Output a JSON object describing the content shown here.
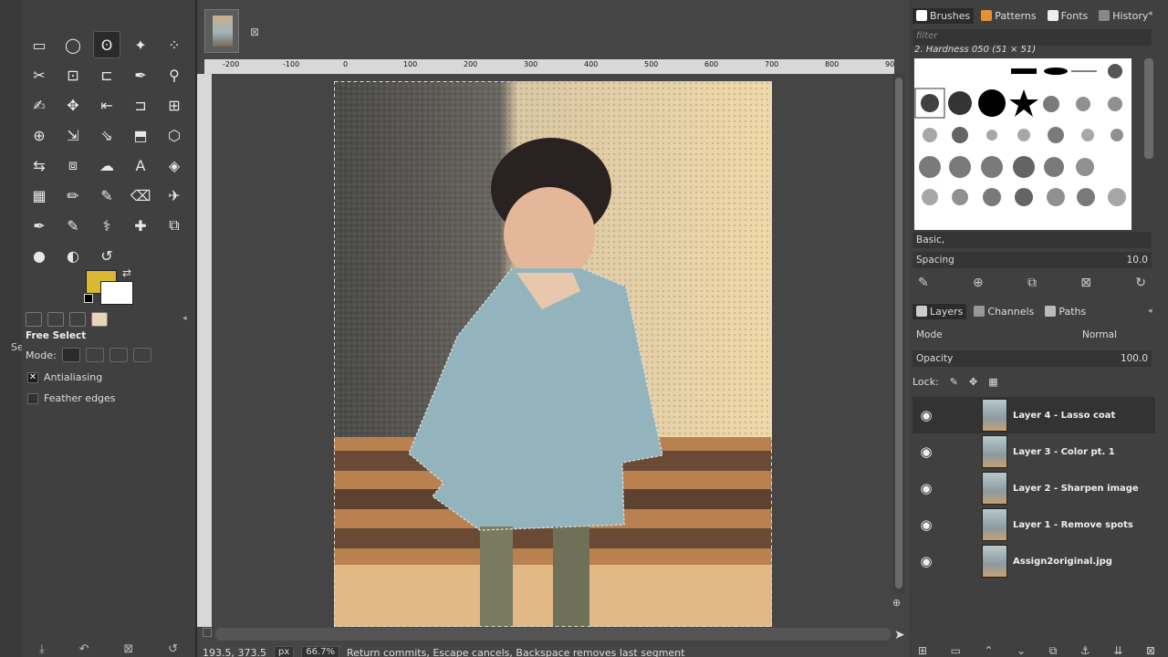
{
  "toolbox": {
    "tools": [
      {
        "name": "rect-select-icon"
      },
      {
        "name": "ellipse-select-icon"
      },
      {
        "name": "free-select-icon",
        "active": true
      },
      {
        "name": "fuzzy-select-icon"
      },
      {
        "name": "select-by-color-icon"
      },
      {
        "name": "scissors-select-icon"
      },
      {
        "name": "foreground-select-icon"
      },
      {
        "name": "crop-icon"
      },
      {
        "name": "color-picker-icon"
      },
      {
        "name": "zoom-icon"
      },
      {
        "name": "paths-icon"
      },
      {
        "name": "move-icon"
      },
      {
        "name": "align-icon"
      },
      {
        "name": "transform-icon"
      },
      {
        "name": "unified-transform-icon"
      },
      {
        "name": "warp-icon"
      },
      {
        "name": "scale-icon"
      },
      {
        "name": "shear-icon"
      },
      {
        "name": "perspective-icon"
      },
      {
        "name": "3d-transform-icon"
      },
      {
        "name": "flip-icon"
      },
      {
        "name": "cage-icon"
      },
      {
        "name": "smudge-icon"
      },
      {
        "name": "text-icon"
      },
      {
        "name": "bucket-fill-icon"
      },
      {
        "name": "gradient-icon"
      },
      {
        "name": "pencil-icon"
      },
      {
        "name": "paintbrush-icon"
      },
      {
        "name": "eraser-icon"
      },
      {
        "name": "airbrush-icon"
      },
      {
        "name": "ink-icon"
      },
      {
        "name": "mypaint-icon"
      },
      {
        "name": "clone-icon"
      },
      {
        "name": "heal-icon"
      },
      {
        "name": "perspective-clone-icon"
      },
      {
        "name": "blur-icon"
      },
      {
        "name": "dodge-icon"
      },
      {
        "name": "smudge-brush-icon"
      }
    ],
    "fg_color": "#d9b832",
    "bg_color": "#ffffff",
    "tool_options_title": "Free Select",
    "mode_label": "Mode:",
    "antialiasing_label": "Antialiasing",
    "antialiasing_checked": true,
    "feather_label": "Feather edges",
    "feather_checked": false,
    "left_fragment": "Se"
  },
  "canvas": {
    "ruler_ticks": [
      "-200",
      "-100",
      "0",
      "100",
      "200",
      "300",
      "400",
      "500",
      "600",
      "700",
      "800",
      "90"
    ],
    "status": {
      "coords": "193.5, 373.5",
      "unit": "px",
      "zoom": "66.7%",
      "message": "Return commits, Escape cancels, Backspace removes last segment"
    }
  },
  "dock": {
    "top_tabs": [
      "Brushes",
      "Patterns",
      "Fonts",
      "History"
    ],
    "filter_placeholder": "filter",
    "brush_name": "2. Hardness 050 (51 × 51)",
    "brush_preset": "Basic,",
    "spacing_label": "Spacing",
    "spacing_value": "10.0",
    "layer_tabs": [
      "Layers",
      "Channels",
      "Paths"
    ],
    "mode_label": "Mode",
    "mode_value": "Normal",
    "opacity_label": "Opacity",
    "opacity_value": "100.0",
    "lock_label": "Lock:",
    "layers": [
      {
        "name": "Layer 4 - Lasso coat",
        "active": true
      },
      {
        "name": "Layer 3 - Color pt. 1"
      },
      {
        "name": "Layer 2 - Sharpen image"
      },
      {
        "name": "Layer 1 - Remove spots"
      },
      {
        "name": "Assign2original.jpg"
      }
    ]
  }
}
